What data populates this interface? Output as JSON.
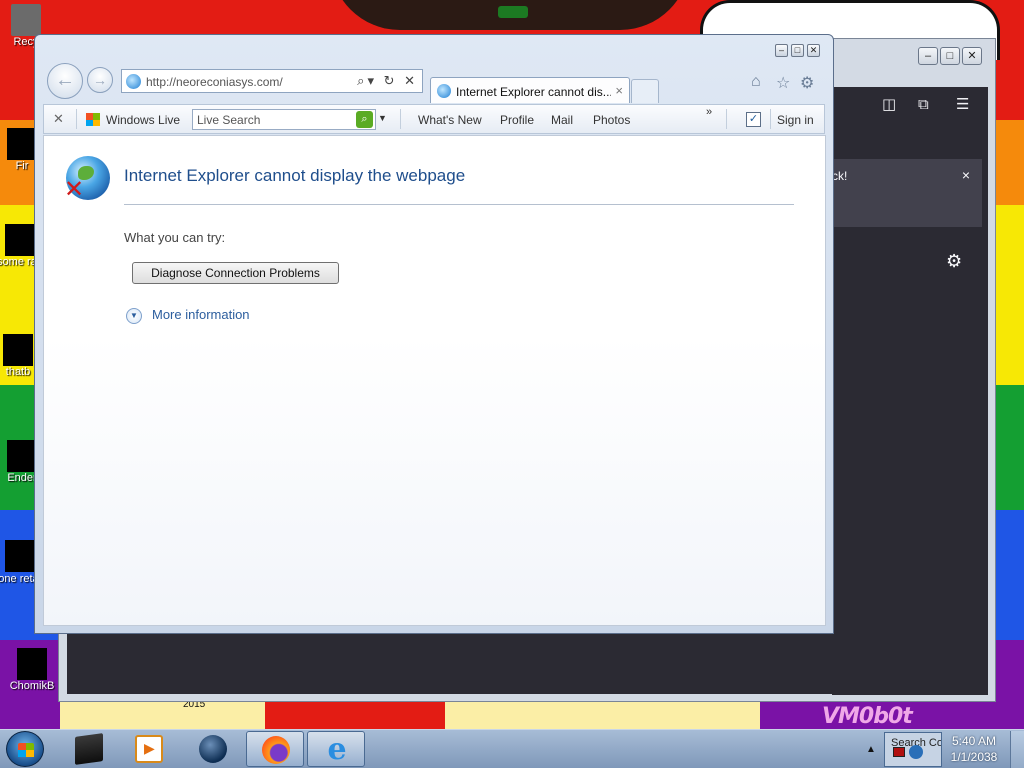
{
  "desktop": {
    "icons": [
      {
        "label": "Recy",
        "name": "recycle-bin"
      },
      {
        "label": "Fir",
        "name": "firefox-shortcut"
      },
      {
        "label": "some ran",
        "name": "some-random-icon"
      },
      {
        "label": "thatb",
        "name": "thatb-icon"
      },
      {
        "label": "Ender",
        "name": "ender-icon"
      },
      {
        "label": "none retarc",
        "name": "none-icon"
      },
      {
        "label": "ChomikB",
        "name": "chomik-icon"
      }
    ],
    "wallpaper_text": "VM0b0t",
    "wallpaper_year": "2015"
  },
  "firefox_window": {
    "notice_text": "ck!",
    "notice_close": "×",
    "toolbar_icons": [
      "pocket-icon",
      "extensions-icon",
      "menu-icon"
    ],
    "settings_icon": "gear-icon"
  },
  "ie_window": {
    "address": {
      "url": "http://neoreconiasys.com/",
      "tools": "⌕▾ ↻ ✕"
    },
    "tab": {
      "title": "Internet Explorer cannot dis...",
      "close": "×"
    },
    "command_icons": [
      "home-icon",
      "favorites-star-icon",
      "tools-gear-icon"
    ],
    "favorites_bar": {
      "close": "✕",
      "windows_live": "Windows Live",
      "search_placeholder": "Live Search",
      "links": [
        "What's New",
        "Profile",
        "Mail",
        "Photos"
      ],
      "chevron": "»",
      "sign_in": "Sign in"
    },
    "page": {
      "title": "Internet Explorer cannot display the webpage",
      "try_text": "What you can try:",
      "diagnose_button": "Diagnose Connection Problems",
      "more_info": "More information"
    }
  },
  "taskbar": {
    "apps": [
      {
        "name": "terminal",
        "active": false
      },
      {
        "name": "media-player",
        "active": false
      },
      {
        "name": "globe-browser",
        "active": false
      },
      {
        "name": "firefox",
        "active": true
      },
      {
        "name": "internet-explorer",
        "active": true
      }
    ],
    "tray_thumb_label": "Search Co",
    "clock_time": "5:40 AM",
    "clock_date": "1/1/2038"
  },
  "colors": {
    "ie_title_blue": "#1f4e8c",
    "link_blue": "#2c5e9e",
    "firefox_dark": "#2b2a33"
  }
}
